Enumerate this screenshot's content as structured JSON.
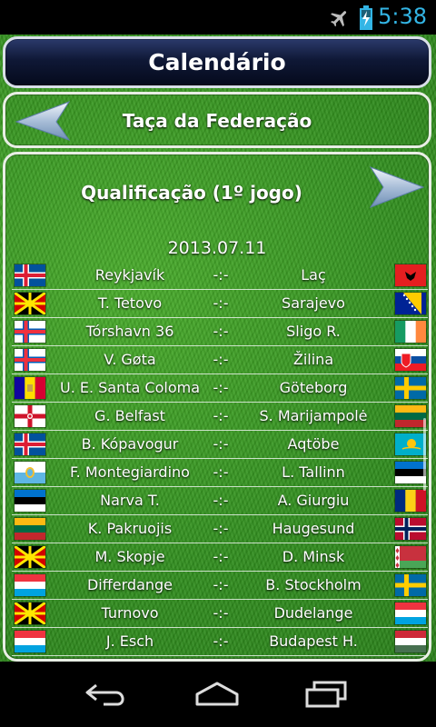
{
  "status_bar": {
    "time": "5:38",
    "icons": [
      "airplane-icon",
      "battery-charging-icon"
    ]
  },
  "header": {
    "title": "Calendário"
  },
  "competition": {
    "name": "Taça da Federação"
  },
  "round": {
    "name": "Qualificação (1º jogo)",
    "date": "2013.07.11"
  },
  "matches": [
    {
      "home": "Reykjavík",
      "score": "-:-",
      "away": "Laç",
      "home_flag": "iceland",
      "away_flag": "albania"
    },
    {
      "home": "T. Tetovo",
      "score": "-:-",
      "away": "Sarajevo",
      "home_flag": "macedonia",
      "away_flag": "bosnia"
    },
    {
      "home": "Tórshavn 36",
      "score": "-:-",
      "away": "Sligo R.",
      "home_flag": "faroe",
      "away_flag": "ireland"
    },
    {
      "home": "V. Gøta",
      "score": "-:-",
      "away": "Žilina",
      "home_flag": "faroe",
      "away_flag": "slovakia"
    },
    {
      "home": "U. E. Santa Coloma",
      "score": "-:-",
      "away": "Göteborg",
      "home_flag": "andorra",
      "away_flag": "sweden"
    },
    {
      "home": "G. Belfast",
      "score": "-:-",
      "away": "S. Marijampolė",
      "home_flag": "northern_ireland",
      "away_flag": "lithuania"
    },
    {
      "home": "B. Kópavogur",
      "score": "-:-",
      "away": "Aqtöbe",
      "home_flag": "iceland",
      "away_flag": "kazakhstan"
    },
    {
      "home": "F. Montegiardino",
      "score": "-:-",
      "away": "L. Tallinn",
      "home_flag": "san_marino",
      "away_flag": "estonia"
    },
    {
      "home": "Narva T.",
      "score": "-:-",
      "away": "A. Giurgiu",
      "home_flag": "estonia",
      "away_flag": "romania"
    },
    {
      "home": "K. Pakruojis",
      "score": "-:-",
      "away": "Haugesund",
      "home_flag": "lithuania",
      "away_flag": "norway"
    },
    {
      "home": "M. Skopje",
      "score": "-:-",
      "away": "D. Minsk",
      "home_flag": "macedonia",
      "away_flag": "belarus"
    },
    {
      "home": "Differdange",
      "score": "-:-",
      "away": "B. Stockholm",
      "home_flag": "luxembourg",
      "away_flag": "sweden"
    },
    {
      "home": "Turnovo",
      "score": "-:-",
      "away": "Dudelange",
      "home_flag": "macedonia",
      "away_flag": "luxembourg"
    },
    {
      "home": "J. Esch",
      "score": "-:-",
      "away": "Budapest H.",
      "home_flag": "luxembourg",
      "away_flag": "hungary"
    }
  ],
  "nav_bar": {
    "buttons": [
      "back-icon",
      "home-icon",
      "recent-apps-icon"
    ]
  },
  "colors": {
    "status_time": "#33b5e5",
    "header_bg": "#0f1836",
    "grass": "#33911f"
  }
}
